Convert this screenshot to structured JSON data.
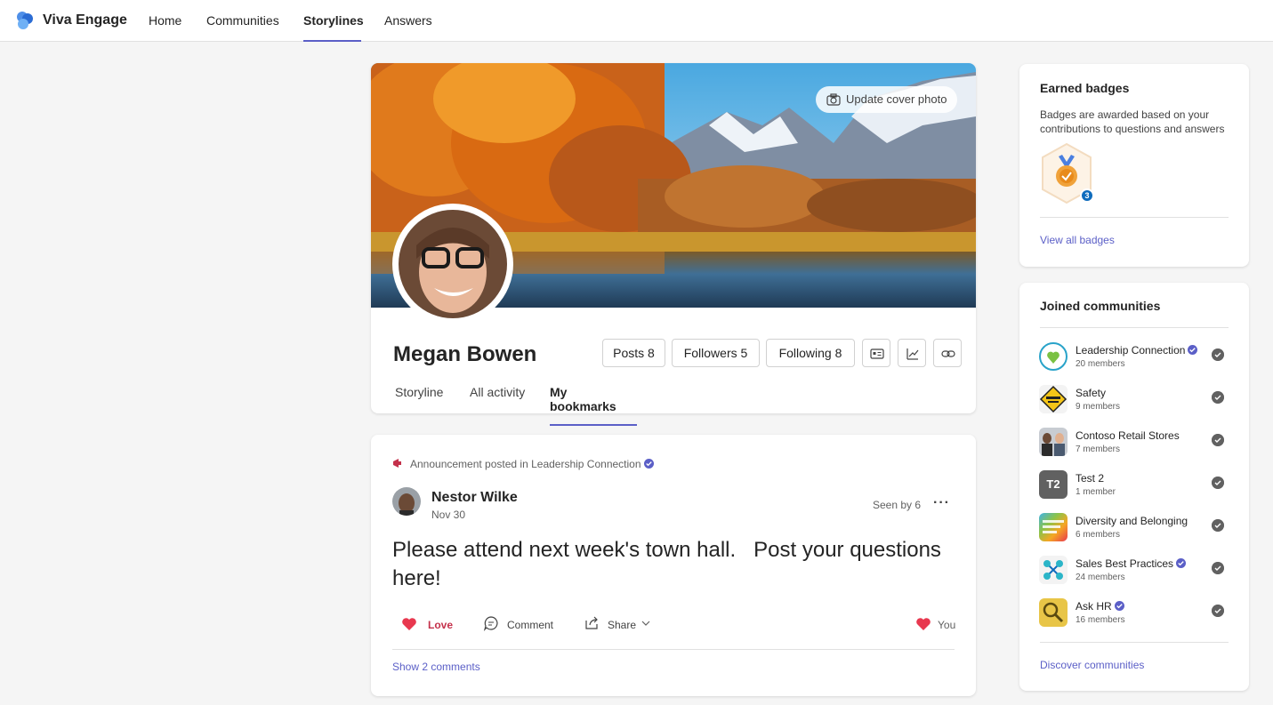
{
  "topbar": {
    "brand": "Viva Engage",
    "nav": [
      "Home",
      "Communities",
      "Storylines",
      "Answers"
    ],
    "active_nav": "Storylines"
  },
  "profile": {
    "update_cover": "Update cover photo",
    "name": "Megan Bowen",
    "posts": "Posts 8",
    "followers": "Followers 5",
    "following": "Following 8",
    "tabs": [
      "Storyline",
      "All activity",
      "My bookmarks"
    ],
    "active_tab": "My bookmarks"
  },
  "post": {
    "announcement": "Announcement posted in Leadership Connection",
    "author": "Nestor Wilke",
    "date": "Nov 30",
    "seen": "Seen by 6",
    "body": "Please attend next week's town hall.   Post your questions here!",
    "love": "Love",
    "comment": "Comment",
    "share": "Share",
    "reacted_by": "You",
    "show_comments": "Show 2 comments"
  },
  "badges": {
    "title": "Earned badges",
    "desc": "Badges are awarded based on your contributions to questions and answers",
    "count": "3",
    "view_all": "View all badges"
  },
  "communities": {
    "title": "Joined communities",
    "items": [
      {
        "name": "Leadership Connection",
        "members": "20 members",
        "verified": true
      },
      {
        "name": "Safety",
        "members": "9 members",
        "verified": false
      },
      {
        "name": "Contoso Retail Stores",
        "members": "7 members",
        "verified": false
      },
      {
        "name": "Test 2",
        "members": "1 member",
        "verified": false,
        "initials": "T2"
      },
      {
        "name": "Diversity and Belonging",
        "members": "6 members",
        "verified": false
      },
      {
        "name": "Sales Best Practices",
        "members": "24 members",
        "verified": true
      },
      {
        "name": "Ask HR",
        "members": "16 members",
        "verified": true
      }
    ],
    "discover": "Discover communities"
  },
  "colors": {
    "accent": "#5b5fc7",
    "love": "#c4314b",
    "page_bg": "#f5f5f5"
  }
}
